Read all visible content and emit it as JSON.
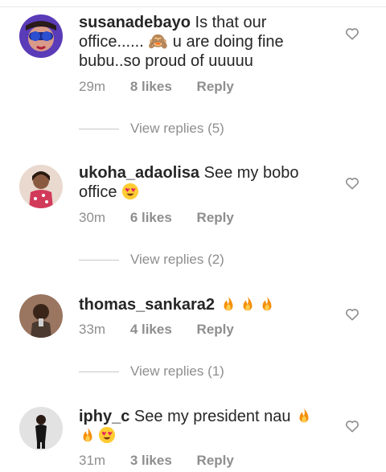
{
  "comments": [
    {
      "username": "susanadebayo",
      "text": "Is that our office...... 🙈 u are doing fine bubu..so proud of uuuuu",
      "time": "29m",
      "likes": "8 likes",
      "reply": "Reply",
      "view_replies": "View replies (5)",
      "avatar_color": "#5a3bb8"
    },
    {
      "username": "ukoha_adaolisa",
      "text": "See my bobo office",
      "emojis": [
        "heart-eyes"
      ],
      "time": "30m",
      "likes": "6 likes",
      "reply": "Reply",
      "view_replies": "View replies (2)",
      "avatar_color": "#c9a38a"
    },
    {
      "username": "thomas_sankara2",
      "text": "",
      "emojis": [
        "fire",
        "fire",
        "fire"
      ],
      "time": "33m",
      "likes": "4 likes",
      "reply": "Reply",
      "view_replies": "View replies (1)",
      "avatar_color": "#7a5a48"
    },
    {
      "username": "iphy_c",
      "text": "See my president nau",
      "emojis": [
        "fire",
        "fire",
        "heart-eyes"
      ],
      "time": "31m",
      "likes": "3 likes",
      "reply": "Reply",
      "avatar_color": "#d8d8d8"
    }
  ],
  "colors": {
    "text": "#262626",
    "muted": "#8e8e8e",
    "heart_outline": "#8e8e8e"
  },
  "icons": {
    "like": "heart-outline-icon"
  }
}
